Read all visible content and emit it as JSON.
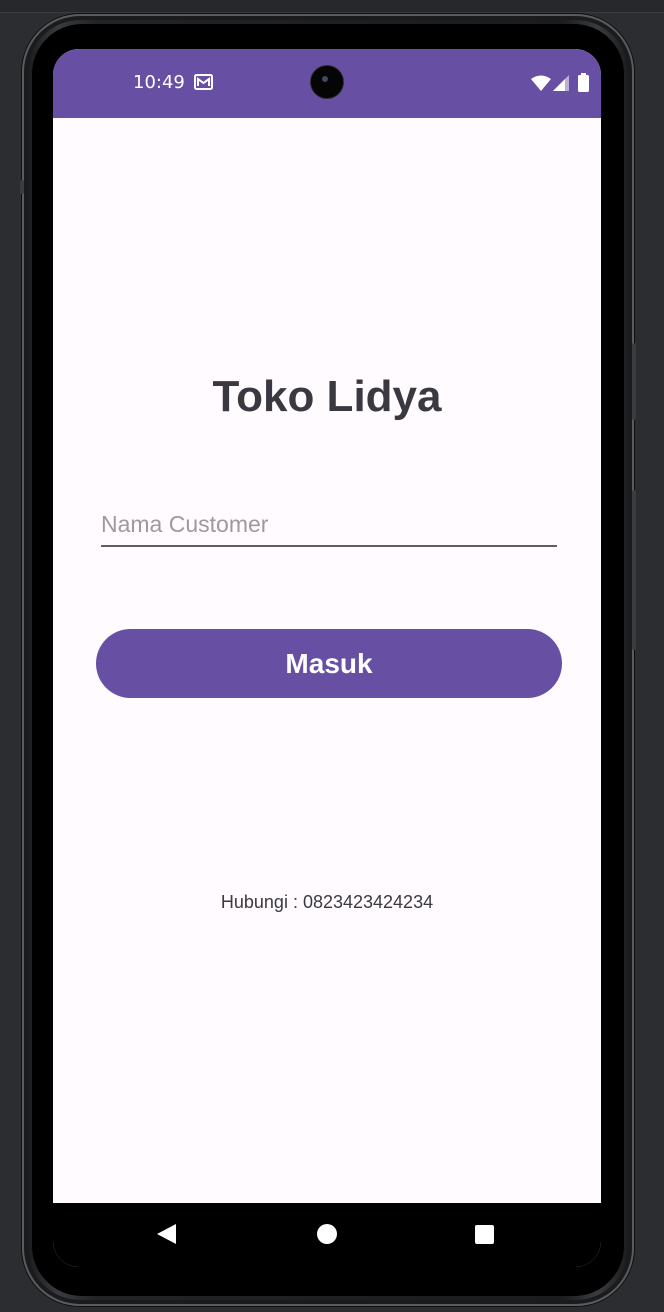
{
  "colors": {
    "primary": "#6750a4",
    "background": "#fffbfe",
    "title_text": "#3a3942",
    "on_primary": "#ffffff"
  },
  "status_bar": {
    "time": "10:49",
    "notification_icon": "gmail-icon",
    "icons": [
      "wifi-icon",
      "signal-icon",
      "battery-icon"
    ]
  },
  "app": {
    "title": "Toko Lidya",
    "name_field": {
      "value": "",
      "placeholder": "Nama Customer"
    },
    "login_button_label": "Masuk",
    "contact_text": "Hubungi : 0823423424234"
  },
  "nav_bar": {
    "icons": [
      "back-icon",
      "home-icon",
      "recents-icon"
    ]
  }
}
